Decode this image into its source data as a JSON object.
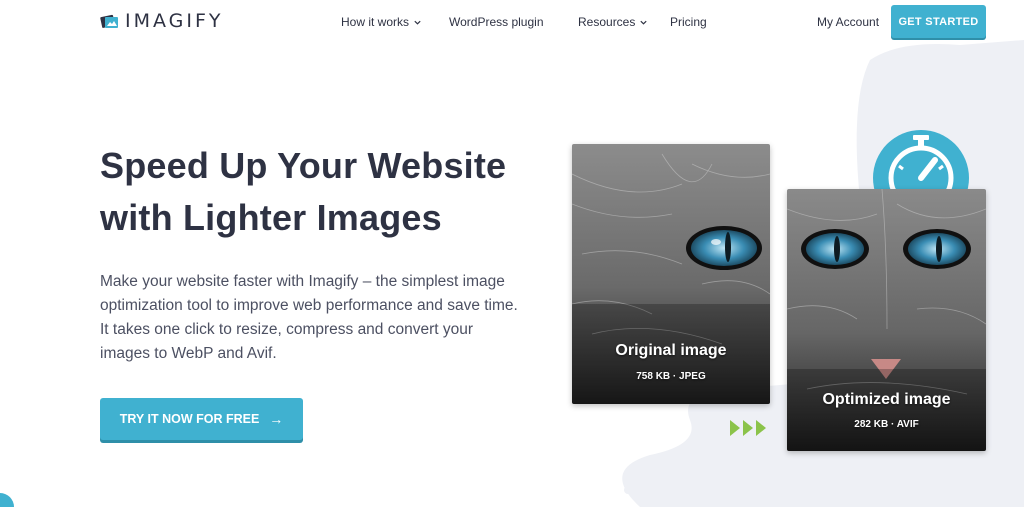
{
  "brand": {
    "name": "IMAGIFY",
    "logo_icon": "imagify-logo-icon"
  },
  "nav": {
    "items": [
      {
        "label": "How it works",
        "dropdown": true
      },
      {
        "label": "WordPress plugin",
        "dropdown": false
      },
      {
        "label": "Resources",
        "dropdown": true
      },
      {
        "label": "Pricing",
        "dropdown": false
      }
    ],
    "account_label": "My Account",
    "cta_label": "GET STARTED"
  },
  "hero": {
    "headline_line1": "Speed Up Your Website",
    "headline_line2": "with Lighter Images",
    "lead": "Make your website faster with Imagify – the simplest image optimization tool to improve web performance and save time. It takes one click to resize, compress and convert your images to WebP and Avif.",
    "cta_label": "TRY IT NOW FOR FREE",
    "cta_icon": "arrow-right-icon"
  },
  "comparison": {
    "original": {
      "title": "Original image",
      "meta": "758 KB · JPEG"
    },
    "optimized": {
      "title": "Optimized image",
      "meta": "282 KB · AVIF"
    },
    "speed_icon": "speedometer-icon",
    "progress_icon": "triple-chevron-right-icon"
  },
  "colors": {
    "accent": "#40b1d0",
    "text_dark": "#2e3243",
    "arrows_green": "#8bc34a",
    "blob": "#eef0f5"
  }
}
